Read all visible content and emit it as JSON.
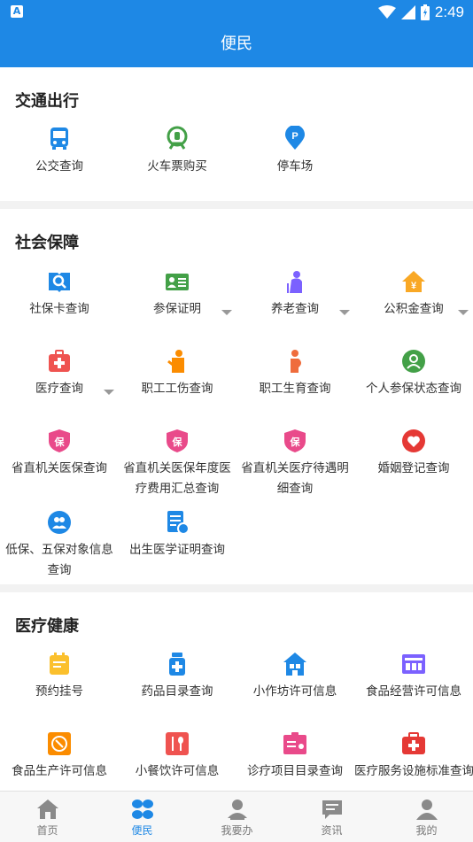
{
  "status_bar": {
    "time": "2:49"
  },
  "header": {
    "title": "便民"
  },
  "sections": [
    {
      "title": "交通出行",
      "items": [
        {
          "label": "公交查询",
          "icon": "bus-icon"
        },
        {
          "label": "火车票购买",
          "icon": "train-icon"
        },
        {
          "label": "停车场",
          "icon": "parking-icon"
        }
      ]
    },
    {
      "title": "社会保障",
      "items": [
        {
          "label": "社保卡查询",
          "icon": "social-card-search-icon"
        },
        {
          "label": "参保证明",
          "icon": "insurance-certificate-icon"
        },
        {
          "label": "养老查询",
          "icon": "elderly-pension-icon"
        },
        {
          "label": "公积金查询",
          "icon": "housing-fund-icon"
        },
        {
          "label": "医疗查询",
          "icon": "medical-kit-icon"
        },
        {
          "label": "职工工伤查询",
          "icon": "work-injury-icon"
        },
        {
          "label": "职工生育查询",
          "icon": "maternity-icon"
        },
        {
          "label": "个人参保状态查询",
          "icon": "personal-status-icon"
        },
        {
          "label": "省直机关医保查询",
          "icon": "shield-bao-icon"
        },
        {
          "label": "省直机关医保年度医疗费用汇总查询",
          "icon": "shield-bao-icon"
        },
        {
          "label": "省直机关医疗待遇明细查询",
          "icon": "shield-bao-icon"
        },
        {
          "label": "婚姻登记查询",
          "icon": "heart-icon"
        },
        {
          "label": "低保、五保对象信息查询",
          "icon": "subsistence-people-icon"
        },
        {
          "label": "出生医学证明查询",
          "icon": "birth-certificate-icon"
        }
      ]
    },
    {
      "title": "医疗健康",
      "items": [
        {
          "label": "预约挂号",
          "icon": "appointment-icon"
        },
        {
          "label": "药品目录查询",
          "icon": "medicine-bottle-icon"
        },
        {
          "label": "小作坊许可信息",
          "icon": "workshop-icon"
        },
        {
          "label": "食品经营许可信息",
          "icon": "food-business-icon"
        },
        {
          "label": "食品生产许可信息",
          "icon": "food-production-icon"
        },
        {
          "label": "小餐饮许可信息",
          "icon": "small-catering-icon"
        },
        {
          "label": "诊疗项目目录查询",
          "icon": "diagnosis-items-icon"
        },
        {
          "label": "医疗服务设施标准查询",
          "icon": "medical-facility-icon"
        }
      ]
    }
  ],
  "tabs": [
    {
      "label": "首页",
      "icon": "home-icon"
    },
    {
      "label": "便民",
      "icon": "convenience-icon",
      "active": true
    },
    {
      "label": "我要办",
      "icon": "user-task-icon"
    },
    {
      "label": "资讯",
      "icon": "news-icon"
    },
    {
      "label": "我的",
      "icon": "profile-icon"
    }
  ],
  "colors": {
    "primary": "#1e88e5",
    "divider": "#f2f2f2"
  }
}
